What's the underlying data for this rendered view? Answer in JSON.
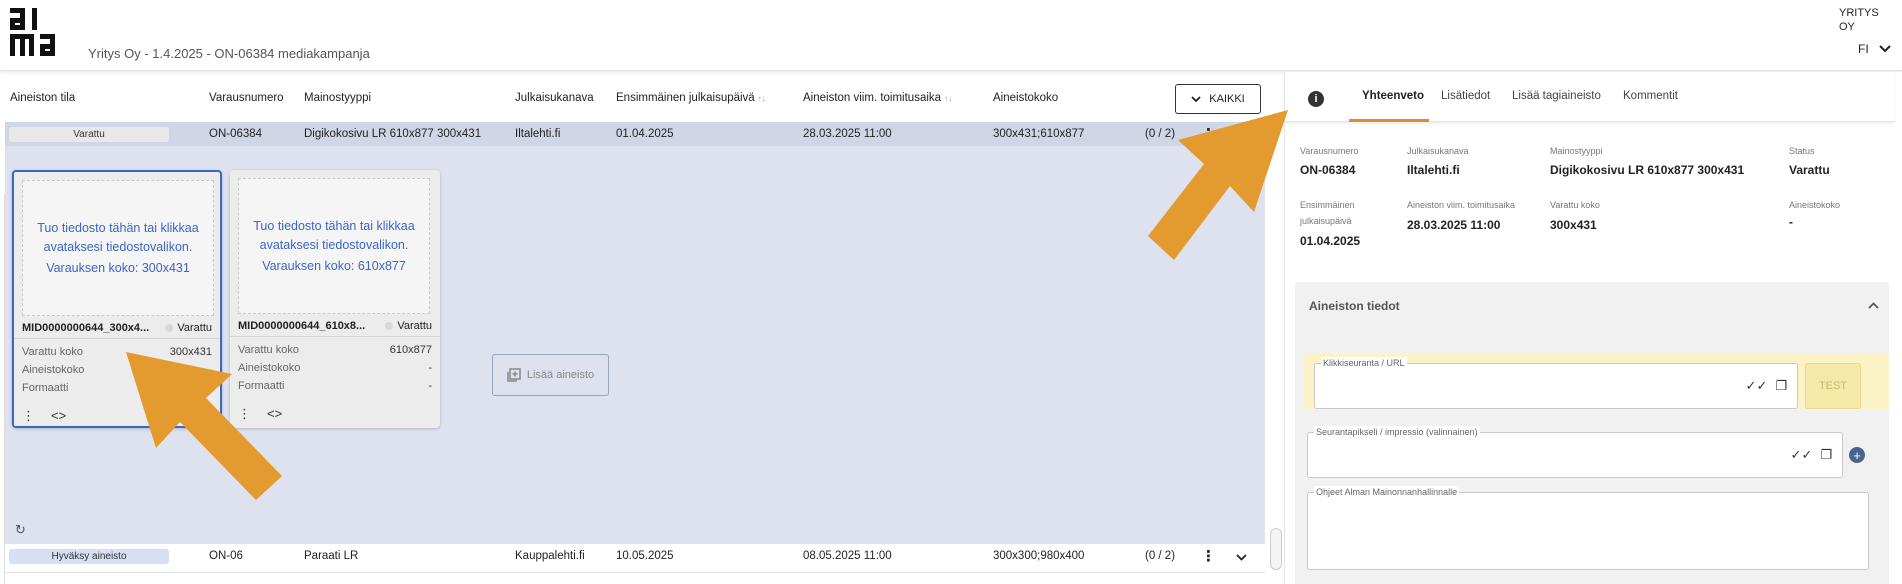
{
  "header": {
    "campaign_title": "Yritys Oy - 1.4.2025 - ON-06384 mediakampanja",
    "company": "YRITYS OY",
    "language": "FI"
  },
  "table": {
    "columns": [
      "Aineiston tila",
      "Varausnumero",
      "Mainostyyppi",
      "Julkaisukanava",
      "Ensimmäinen julkaisupäivä",
      "Aineiston viim. toimitusaika",
      "Aineistokoko"
    ],
    "filter_button": "KAIKKI",
    "rows": [
      {
        "status": "Varattu",
        "number": "ON-06384",
        "ad_type": "Digikokosivu LR 610x877 300x431",
        "channel": "Iltalehti.fi",
        "first_date": "01.04.2025",
        "deadline": "28.03.2025 11:00",
        "size": "300x431;610x877",
        "count": "(0 / 2)"
      },
      {
        "status": "Hyväksy aineisto",
        "number": "ON-06",
        "ad_type": "Paraati LR",
        "channel": "Kauppalehti.fi",
        "first_date": "10.05.2025",
        "deadline": "08.05.2025 11:00",
        "size": "300x300;980x400",
        "count": "(0 / 2)"
      }
    ],
    "cards": [
      {
        "drop_line1": "Tuo tiedosto tähän tai klikkaa",
        "drop_line2": "avataksesi tiedostovalikon.",
        "drop_line3": "Varauksen koko: 300x431",
        "name": "MID0000000644_300x4...",
        "status": "Varattu",
        "reserved_size_label": "Varattu koko",
        "reserved_size": "300x431",
        "material_size_label": "Aineistokoko",
        "material_size": "-",
        "format_label": "Formaatti",
        "format": "-"
      },
      {
        "drop_line1": "Tuo tiedosto tähän tai klikkaa",
        "drop_line2": "avataksesi tiedostovalikon.",
        "drop_line3": "Varauksen koko: 610x877",
        "name": "MID0000000644_610x8...",
        "status": "Varattu",
        "reserved_size_label": "Varattu koko",
        "reserved_size": "610x877",
        "material_size_label": "Aineistokoko",
        "material_size": "-",
        "format_label": "Formaatti",
        "format": "-"
      }
    ],
    "add_material": "Lisää aineisto"
  },
  "panel": {
    "tabs": [
      "Yhteenveto",
      "Lisätiedot",
      "Lisää tagiaineisto",
      "Kommentit"
    ],
    "summary": {
      "number_label": "Varausnumero",
      "number": "ON-06384",
      "channel_label": "Julkaisukanava",
      "channel": "Iltalehti.fi",
      "ad_type_label": "Mainostyyppi",
      "ad_type": "Digikokosivu LR 610x877 300x431",
      "status_label": "Status",
      "status": "Varattu",
      "first_date_label1": "Ensimmäinen",
      "first_date_label2": "julkaisupäivä",
      "first_date": "01.04.2025",
      "deadline_label": "Aineiston viim. toimitusaika",
      "deadline": "28.03.2025 11:00",
      "reserved_size_label": "Varattu koko",
      "reserved_size": "300x431",
      "material_size_label": "Aineistokoko",
      "material_size": "-"
    },
    "section_title": "Aineiston tiedot",
    "fields": {
      "click_url_label": "Klikkiseuranta / URL",
      "tracking_pixel_label": "Seurantapikseli / impressio (valinnainen)",
      "instructions_label": "Ohjeet Alman Mainonnanhallinnalle"
    },
    "test_button": "TEST"
  },
  "colors": {
    "accent": "#d4902c",
    "selected_row": "#cfd6e6",
    "expanded_bg": "#dde2ee",
    "link_blue": "#3a66c4",
    "highlight": "#fbf3c6"
  }
}
